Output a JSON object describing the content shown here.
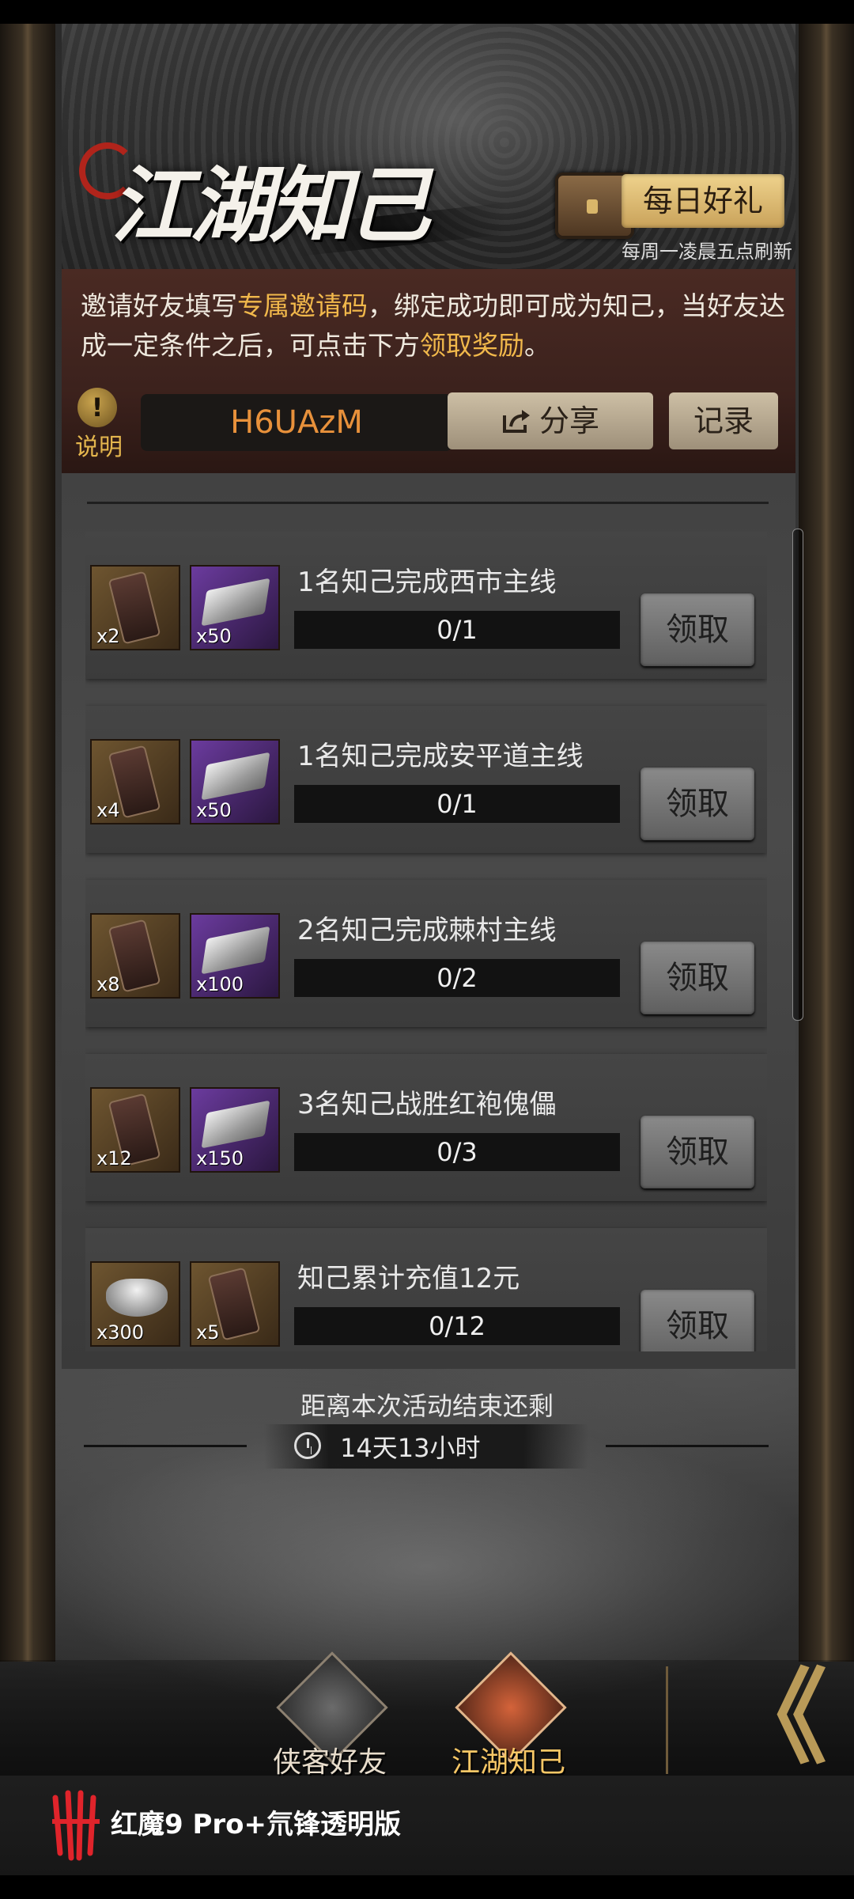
{
  "header": {
    "title": "江湖知己",
    "daily_gift_label": "每日好礼",
    "refresh_note": "每周一凌晨五点刷新"
  },
  "notice": {
    "part1": "邀请好友填写",
    "highlight1": "专属邀请码",
    "part2": "，绑定成功即可成为知己，当好友达成一定条件之后，可点击下方",
    "highlight2": "领取奖励",
    "part3": "。"
  },
  "invite": {
    "help_label": "说明",
    "help_glyph": "!",
    "code": "H6UAzM",
    "share_label": "分享",
    "record_label": "记录"
  },
  "tasks": [
    {
      "title": "1名知己完成西市主线",
      "progress": "0/1",
      "claim_label": "领取",
      "rewards": [
        {
          "type": "token",
          "frame": "gold",
          "count": "x2"
        },
        {
          "type": "ingot",
          "frame": "purple",
          "count": "x50"
        }
      ]
    },
    {
      "title": "1名知己完成安平道主线",
      "progress": "0/1",
      "claim_label": "领取",
      "rewards": [
        {
          "type": "token",
          "frame": "gold",
          "count": "x4"
        },
        {
          "type": "ingot",
          "frame": "purple",
          "count": "x50"
        }
      ]
    },
    {
      "title": "2名知己完成棘村主线",
      "progress": "0/2",
      "claim_label": "领取",
      "rewards": [
        {
          "type": "token",
          "frame": "gold",
          "count": "x8"
        },
        {
          "type": "ingot",
          "frame": "purple",
          "count": "x100"
        }
      ]
    },
    {
      "title": "3名知己战胜红袍傀儡",
      "progress": "0/3",
      "claim_label": "领取",
      "rewards": [
        {
          "type": "token",
          "frame": "gold",
          "count": "x12"
        },
        {
          "type": "ingot",
          "frame": "purple",
          "count": "x150"
        }
      ]
    },
    {
      "title": "知己累计充值12元",
      "progress": "0/12",
      "claim_label": "领取",
      "rewards": [
        {
          "type": "yuanbao",
          "frame": "gold",
          "count": "x300"
        },
        {
          "type": "token",
          "frame": "gold",
          "count": "x5"
        }
      ]
    }
  ],
  "countdown": {
    "label": "距离本次活动结束还剩",
    "remaining": "14天13小时"
  },
  "nav": {
    "items": [
      {
        "label": "侠客好友",
        "active": false
      },
      {
        "label": "江湖知己",
        "active": true
      }
    ],
    "back_glyph": "《"
  },
  "footer": {
    "device_text": "红魔9 Pro+氘锋透明版"
  },
  "colors": {
    "highlight": "#f1b84b",
    "code_text": "#e8913b",
    "gold_button": "#e0c27a"
  }
}
